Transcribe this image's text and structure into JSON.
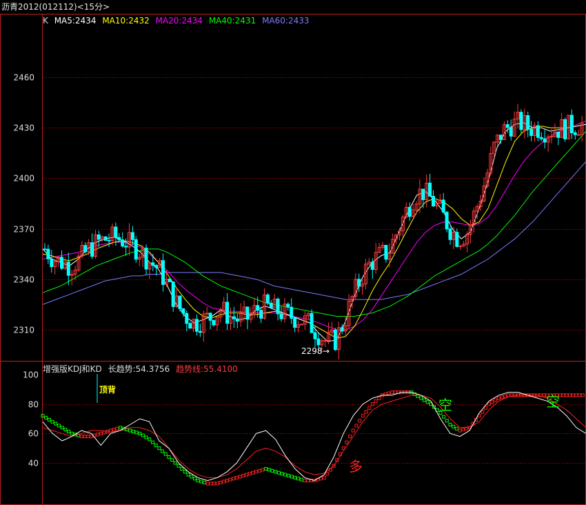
{
  "window": {
    "title": "沥青2012(012112)<15分>"
  },
  "price_legend": {
    "k_label": "K",
    "ma5": "MA5:2434",
    "ma10": "MA10:2432",
    "ma20": "MA20:2434",
    "ma40": "MA40:2431",
    "ma60": "MA60:2433"
  },
  "indicator_legend": {
    "name": "增强版KDJ和KD",
    "long_trend": "长趋势:54.3756",
    "trend_line": "趋势线:55.4100"
  },
  "annotations": {
    "low_marker": "2298",
    "top_divergence": "顶背",
    "buy_signal": "多",
    "sell_signal_1": "空",
    "sell_signal_2": "空"
  },
  "colors": {
    "up": "#ff3b3b",
    "down": "#00ffff",
    "ma5": "#ffffff",
    "ma10": "#ffff00",
    "ma20": "#ff00ff",
    "ma40": "#00ff00",
    "ma60": "#7b7bff",
    "grid": "#8b0000",
    "frame": "#c02020"
  },
  "chart_data": [
    {
      "type": "candlestick",
      "title": "沥青2012(012112)<15分>",
      "yticks": [
        2310,
        2340,
        2370,
        2400,
        2430,
        2460
      ],
      "ylim": [
        2290,
        2480
      ],
      "low_annotation": 2298,
      "ma5_series": [
        2358,
        2352,
        2350,
        2348,
        2352,
        2358,
        2362,
        2364,
        2365,
        2363,
        2360,
        2356,
        2350,
        2346,
        2336,
        2325,
        2318,
        2314,
        2316,
        2318,
        2322,
        2318,
        2316,
        2317,
        2322,
        2324,
        2322,
        2320,
        2318,
        2316,
        2314,
        2308,
        2303,
        2304,
        2315,
        2330,
        2342,
        2350,
        2354,
        2356,
        2368,
        2380,
        2390,
        2392,
        2387,
        2380,
        2370,
        2364,
        2368,
        2382,
        2398,
        2418,
        2428,
        2432,
        2433,
        2430,
        2430,
        2428,
        2429,
        2430,
        2431,
        2432
      ],
      "ma10_series": [
        2355,
        2354,
        2352,
        2351,
        2353,
        2355,
        2358,
        2360,
        2362,
        2363,
        2362,
        2360,
        2356,
        2350,
        2343,
        2335,
        2328,
        2322,
        2318,
        2317,
        2319,
        2320,
        2320,
        2319,
        2319,
        2320,
        2321,
        2320,
        2318,
        2316,
        2314,
        2311,
        2308,
        2305,
        2306,
        2312,
        2322,
        2333,
        2342,
        2350,
        2360,
        2370,
        2380,
        2386,
        2388,
        2386,
        2382,
        2376,
        2372,
        2374,
        2382,
        2396,
        2410,
        2422,
        2428,
        2430,
        2431,
        2430,
        2430,
        2430,
        2431,
        2432
      ],
      "ma20_series": [
        2352,
        2353,
        2354,
        2355,
        2356,
        2358,
        2360,
        2361,
        2362,
        2362,
        2361,
        2359,
        2355,
        2350,
        2345,
        2339,
        2334,
        2330,
        2326,
        2323,
        2322,
        2321,
        2321,
        2320,
        2320,
        2320,
        2320,
        2319,
        2318,
        2317,
        2316,
        2314,
        2312,
        2310,
        2310,
        2312,
        2316,
        2322,
        2330,
        2338,
        2346,
        2354,
        2362,
        2368,
        2372,
        2374,
        2374,
        2373,
        2372,
        2373,
        2377,
        2384,
        2393,
        2402,
        2410,
        2416,
        2421,
        2425,
        2428,
        2430,
        2432,
        2434
      ],
      "ma40_series": [
        2332,
        2334,
        2336,
        2339,
        2342,
        2345,
        2348,
        2350,
        2352,
        2354,
        2356,
        2357,
        2358,
        2358,
        2356,
        2353,
        2350,
        2346,
        2342,
        2339,
        2336,
        2334,
        2332,
        2330,
        2328,
        2326,
        2325,
        2324,
        2323,
        2322,
        2321,
        2320,
        2319,
        2318,
        2318,
        2318,
        2319,
        2320,
        2322,
        2324,
        2327,
        2330,
        2334,
        2338,
        2342,
        2345,
        2348,
        2351,
        2354,
        2357,
        2361,
        2366,
        2372,
        2378,
        2385,
        2392,
        2398,
        2404,
        2410,
        2416,
        2422,
        2428
      ],
      "ma60_series": [
        2325,
        2327,
        2329,
        2331,
        2333,
        2335,
        2337,
        2339,
        2340,
        2341,
        2342,
        2342,
        2343,
        2343,
        2344,
        2344,
        2344,
        2344,
        2344,
        2344,
        2344,
        2343,
        2342,
        2341,
        2340,
        2338,
        2336,
        2335,
        2334,
        2333,
        2332,
        2331,
        2330,
        2329,
        2328,
        2328,
        2328,
        2328,
        2328,
        2329,
        2330,
        2331,
        2333,
        2335,
        2337,
        2339,
        2341,
        2343,
        2346,
        2349,
        2352,
        2356,
        2360,
        2364,
        2369,
        2374,
        2380,
        2386,
        2392,
        2398,
        2404,
        2410
      ]
    },
    {
      "type": "line",
      "title": "增强版KDJ和KD",
      "yticks": [
        40,
        60,
        80,
        100
      ],
      "ylim": [
        25,
        105
      ],
      "series": [
        {
          "name": "长趋势",
          "last": 54.3756
        },
        {
          "name": "趋势线",
          "last": 55.41
        }
      ],
      "white_line": [
        68,
        60,
        55,
        58,
        62,
        60,
        52,
        60,
        62,
        66,
        70,
        68,
        55,
        50,
        40,
        34,
        30,
        28,
        30,
        34,
        40,
        50,
        60,
        62,
        56,
        45,
        36,
        30,
        28,
        32,
        44,
        60,
        72,
        80,
        84,
        86,
        86,
        88,
        88,
        86,
        82,
        70,
        60,
        58,
        62,
        74,
        82,
        86,
        88,
        88,
        86,
        84,
        82,
        78,
        72,
        64,
        60
      ],
      "red_line": [
        64,
        62,
        60,
        58,
        60,
        62,
        62,
        61,
        62,
        64,
        64,
        62,
        58,
        50,
        42,
        36,
        32,
        30,
        30,
        32,
        36,
        42,
        48,
        50,
        48,
        44,
        38,
        34,
        32,
        33,
        38,
        48,
        58,
        68,
        76,
        80,
        82,
        84,
        86,
        86,
        84,
        78,
        70,
        64,
        64,
        68,
        76,
        82,
        85,
        86,
        86,
        86,
        84,
        80,
        76,
        70,
        64
      ],
      "dotted_line": [
        72,
        68,
        64,
        60,
        58,
        58,
        60,
        62,
        64,
        62,
        60,
        56,
        50,
        44,
        38,
        32,
        28,
        26,
        26,
        28,
        30,
        32,
        34,
        36,
        34,
        32,
        30,
        28,
        28,
        30,
        38,
        50,
        62,
        72,
        80,
        86,
        88,
        88,
        88,
        84,
        80,
        74,
        66,
        62,
        64,
        72,
        80,
        84,
        86,
        86,
        86,
        86,
        86,
        86,
        86,
        86,
        86
      ]
    }
  ]
}
